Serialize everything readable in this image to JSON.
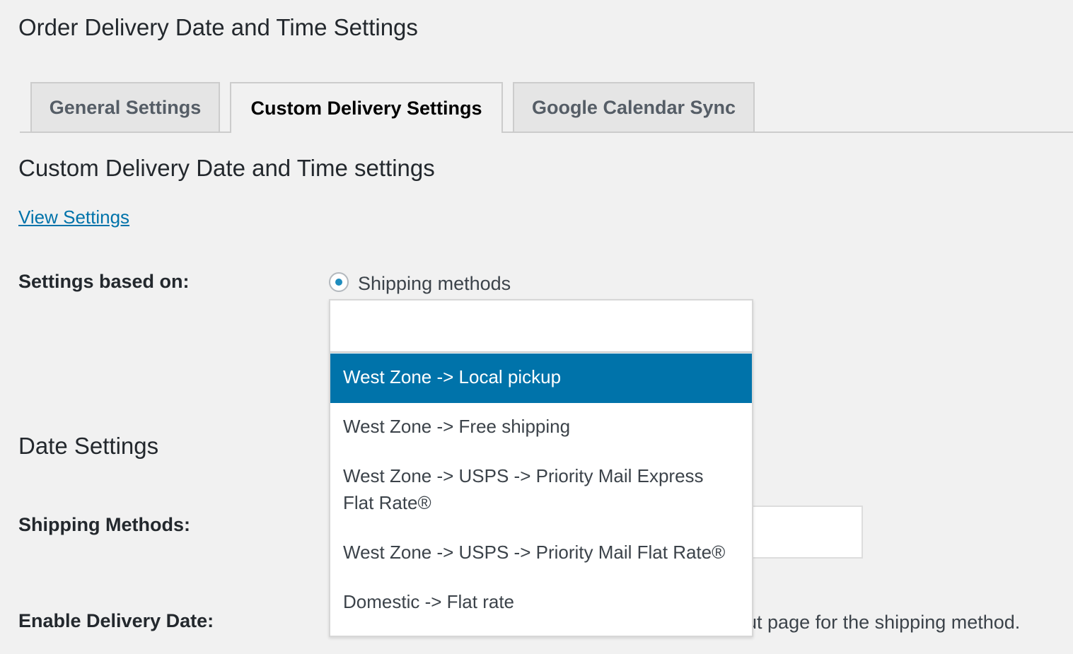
{
  "page_title": "Order Delivery Date and Time Settings",
  "tabs": [
    {
      "label": "General Settings",
      "active": false
    },
    {
      "label": "Custom Delivery Settings",
      "active": true
    },
    {
      "label": "Google Calendar Sync",
      "active": false
    }
  ],
  "section_title": "Custom Delivery Date and Time settings",
  "view_settings_link": "View Settings",
  "settings_based_on": {
    "label": "Settings based on:",
    "radio_label": "Shipping methods"
  },
  "dropdown": {
    "search_value": "",
    "options": [
      "West Zone -> Local pickup",
      "West Zone -> Free shipping",
      "West Zone -> USPS -> Priority Mail Express Flat Rate®",
      "West Zone -> USPS -> Priority Mail Flat Rate®",
      "Domestic -> Flat rate"
    ],
    "highlighted_index": 0
  },
  "date_settings": {
    "title": "Date Settings",
    "shipping_methods_label": "Shipping Methods:",
    "enable_delivery_date_label": "Enable Delivery Date:",
    "enable_delivery_date_desc_visible": "out page for the shipping method."
  },
  "colors": {
    "accent": "#0073aa",
    "background": "#f1f1f1"
  }
}
